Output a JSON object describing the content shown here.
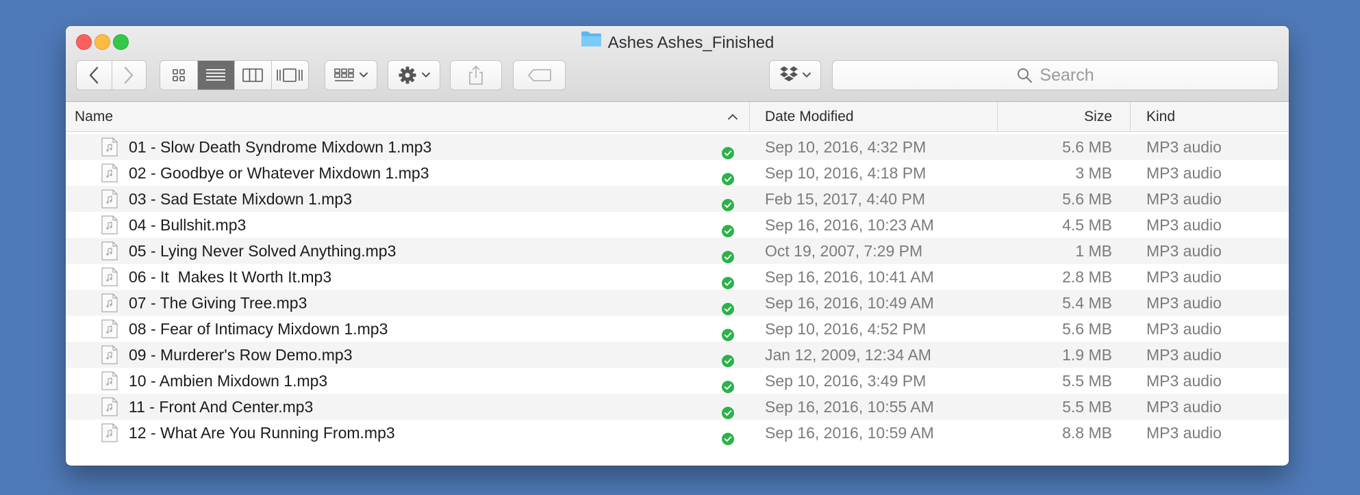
{
  "window": {
    "title": "Ashes Ashes_Finished",
    "icons": [
      "folder-icon"
    ]
  },
  "toolbar": {
    "icons": [
      "back-icon",
      "forward-icon",
      "icon-view-icon",
      "list-view-icon",
      "column-view-icon",
      "cover-flow-view-icon",
      "group-by-icon",
      "gear-icon",
      "share-icon",
      "tag-icon",
      "dropbox-icon"
    ],
    "active_view": "list"
  },
  "search": {
    "placeholder": "Search"
  },
  "columns": {
    "name": "Name",
    "date_modified": "Date Modified",
    "size": "Size",
    "kind": "Kind"
  },
  "files": [
    {
      "name": "01 - Slow Death Syndrome Mixdown 1.mp3",
      "date": "Sep 10, 2016, 4:32 PM",
      "size": "5.6 MB",
      "kind": "MP3 audio"
    },
    {
      "name": "02 - Goodbye or Whatever Mixdown 1.mp3",
      "date": "Sep 10, 2016, 4:18 PM",
      "size": "3 MB",
      "kind": "MP3 audio"
    },
    {
      "name": "03 - Sad Estate Mixdown 1.mp3",
      "date": "Feb 15, 2017, 4:40 PM",
      "size": "5.6 MB",
      "kind": "MP3 audio"
    },
    {
      "name": "04 - Bullshit.mp3",
      "date": "Sep 16, 2016, 10:23 AM",
      "size": "4.5 MB",
      "kind": "MP3 audio"
    },
    {
      "name": "05 - Lying Never Solved Anything.mp3",
      "date": "Oct 19, 2007, 7:29 PM",
      "size": "1 MB",
      "kind": "MP3 audio"
    },
    {
      "name": "06 - It  Makes It Worth It.mp3",
      "date": "Sep 16, 2016, 10:41 AM",
      "size": "2.8 MB",
      "kind": "MP3 audio"
    },
    {
      "name": "07 - The Giving Tree.mp3",
      "date": "Sep 16, 2016, 10:49 AM",
      "size": "5.4 MB",
      "kind": "MP3 audio"
    },
    {
      "name": "08 - Fear of Intimacy Mixdown 1.mp3",
      "date": "Sep 10, 2016, 4:52 PM",
      "size": "5.6 MB",
      "kind": "MP3 audio"
    },
    {
      "name": "09 - Murderer's Row Demo.mp3",
      "date": "Jan 12, 2009, 12:34 AM",
      "size": "1.9 MB",
      "kind": "MP3 audio"
    },
    {
      "name": "10 - Ambien Mixdown 1.mp3",
      "date": "Sep 10, 2016, 3:49 PM",
      "size": "5.5 MB",
      "kind": "MP3 audio"
    },
    {
      "name": "11 - Front And Center.mp3",
      "date": "Sep 16, 2016, 10:55 AM",
      "size": "5.5 MB",
      "kind": "MP3 audio"
    },
    {
      "name": "12 - What Are You Running From.mp3",
      "date": "Sep 16, 2016, 10:59 AM",
      "size": "8.8 MB",
      "kind": "MP3 audio"
    }
  ],
  "colors": {
    "desktop": "#4f7ab8",
    "sync_check": "#2cb24a",
    "active_segment": "#6d6d6d"
  }
}
